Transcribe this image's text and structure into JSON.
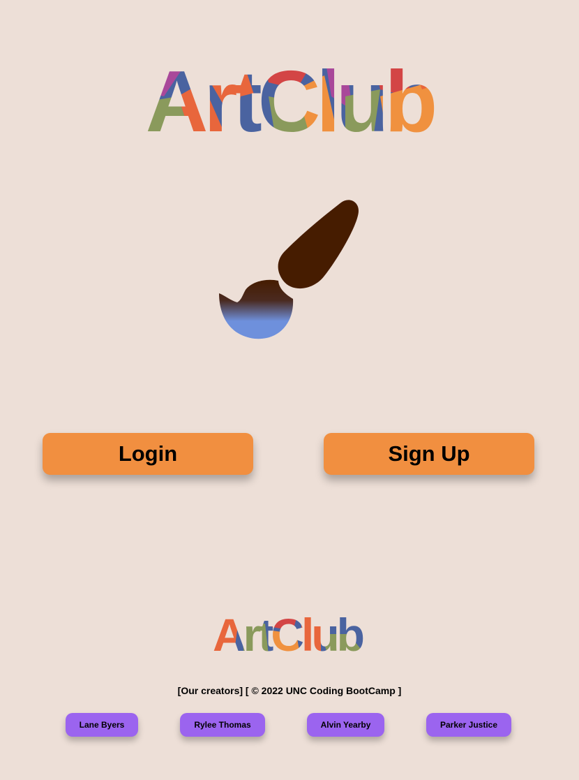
{
  "brand": {
    "name": "ArtClub"
  },
  "auth": {
    "login_label": "Login",
    "signup_label": "Sign Up"
  },
  "footer": {
    "creators_label": "[Our creators]",
    "copyright": "[ © 2022 UNC Coding BootCamp ]",
    "creators": [
      {
        "name": "Lane Byers"
      },
      {
        "name": "Rylee Thomas"
      },
      {
        "name": "Alvin Yearby"
      },
      {
        "name": "Parker Justice"
      }
    ]
  },
  "colors": {
    "background": "#eddfd7",
    "button": "#f18f40",
    "creator_button": "#9b64ef",
    "brush_handle": "#461c00",
    "brush_tip": "#6e90dc"
  },
  "icons": {
    "hero": "paintbrush-icon"
  }
}
